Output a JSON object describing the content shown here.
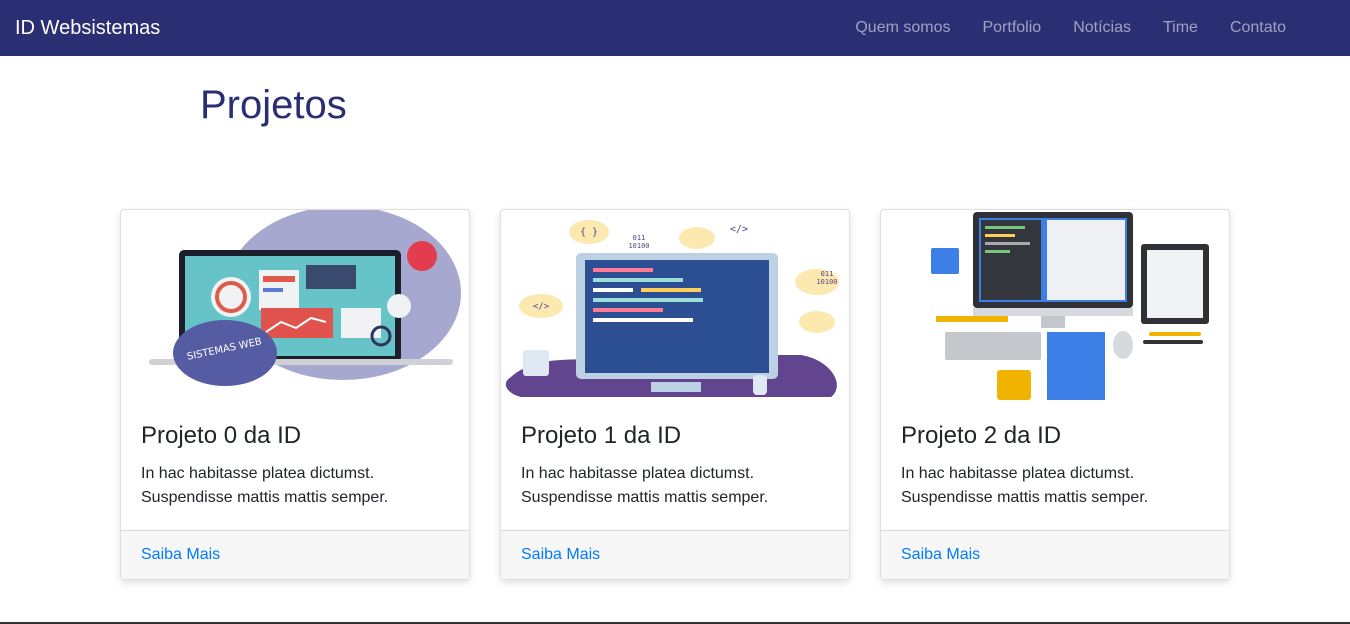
{
  "navbar": {
    "brand": "ID Websistemas",
    "links": [
      "Quem somos",
      "Portfolio",
      "Notícias",
      "Time",
      "Contato"
    ]
  },
  "main": {
    "title": "Projetos",
    "cards": [
      {
        "title": "Projeto 0 da ID",
        "text": "In hac habitasse platea dictumst. Suspendisse mattis mattis semper.",
        "link": "Saiba Mais",
        "image_icon": "laptop-dashboard-illustration",
        "image_text": "SISTEMAS WEB"
      },
      {
        "title": "Projeto 1 da ID",
        "text": "In hac habitasse platea dictumst. Suspendisse mattis mattis semper.",
        "link": "Saiba Mais",
        "image_icon": "monitor-coding-illustration",
        "image_text": [
          "{ }",
          "011",
          "10100",
          "</>",
          "</>",
          "011",
          "10100"
        ]
      },
      {
        "title": "Projeto 2 da ID",
        "text": "In hac habitasse platea dictumst. Suspendisse mattis mattis semper.",
        "link": "Saiba Mais",
        "image_icon": "workstation-flowchart-illustration"
      }
    ]
  },
  "colors": {
    "navbar_bg": "#2a2e72",
    "title": "#2a2e72",
    "link": "#007bff"
  }
}
